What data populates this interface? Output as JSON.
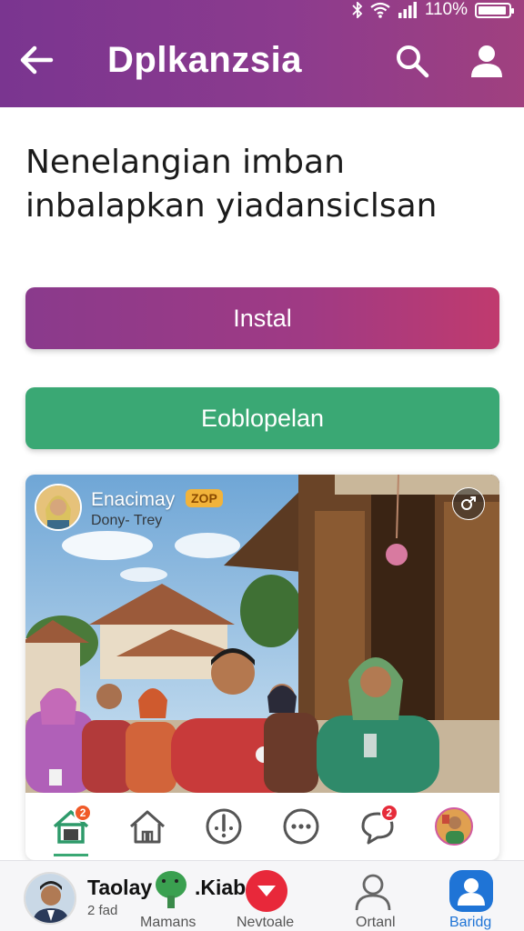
{
  "status": {
    "battery_text": "110%",
    "battery_level": 0.95
  },
  "header": {
    "title": "Dplkanzsia"
  },
  "headline": "Nenelangian imban inbalapkan yiadansiclsan",
  "buttons": {
    "install": "Instal",
    "secondary": "Eoblopelan"
  },
  "post": {
    "name": "Enacimay",
    "badge": "ZOP",
    "subtitle": "Dony- Trey"
  },
  "icon_row": {
    "home_badge": "2",
    "chat_badge": "2",
    "icons": [
      "home-icon",
      "house-icon",
      "alert-face-icon",
      "more-icon",
      "chat-icon",
      "avatar-icon"
    ]
  },
  "bottom_nav": {
    "name": "Taolay",
    "sub": "2 fad",
    "kiab": ".Kiab",
    "labels": [
      "Mamans",
      "Nevtoale",
      "Ortanl",
      "Baridg"
    ]
  },
  "colors": {
    "header": "#8c3b8e",
    "install": "#a03a84",
    "secondary": "#3aa874",
    "active": "#1f74d6",
    "alert": "#e8283a"
  }
}
